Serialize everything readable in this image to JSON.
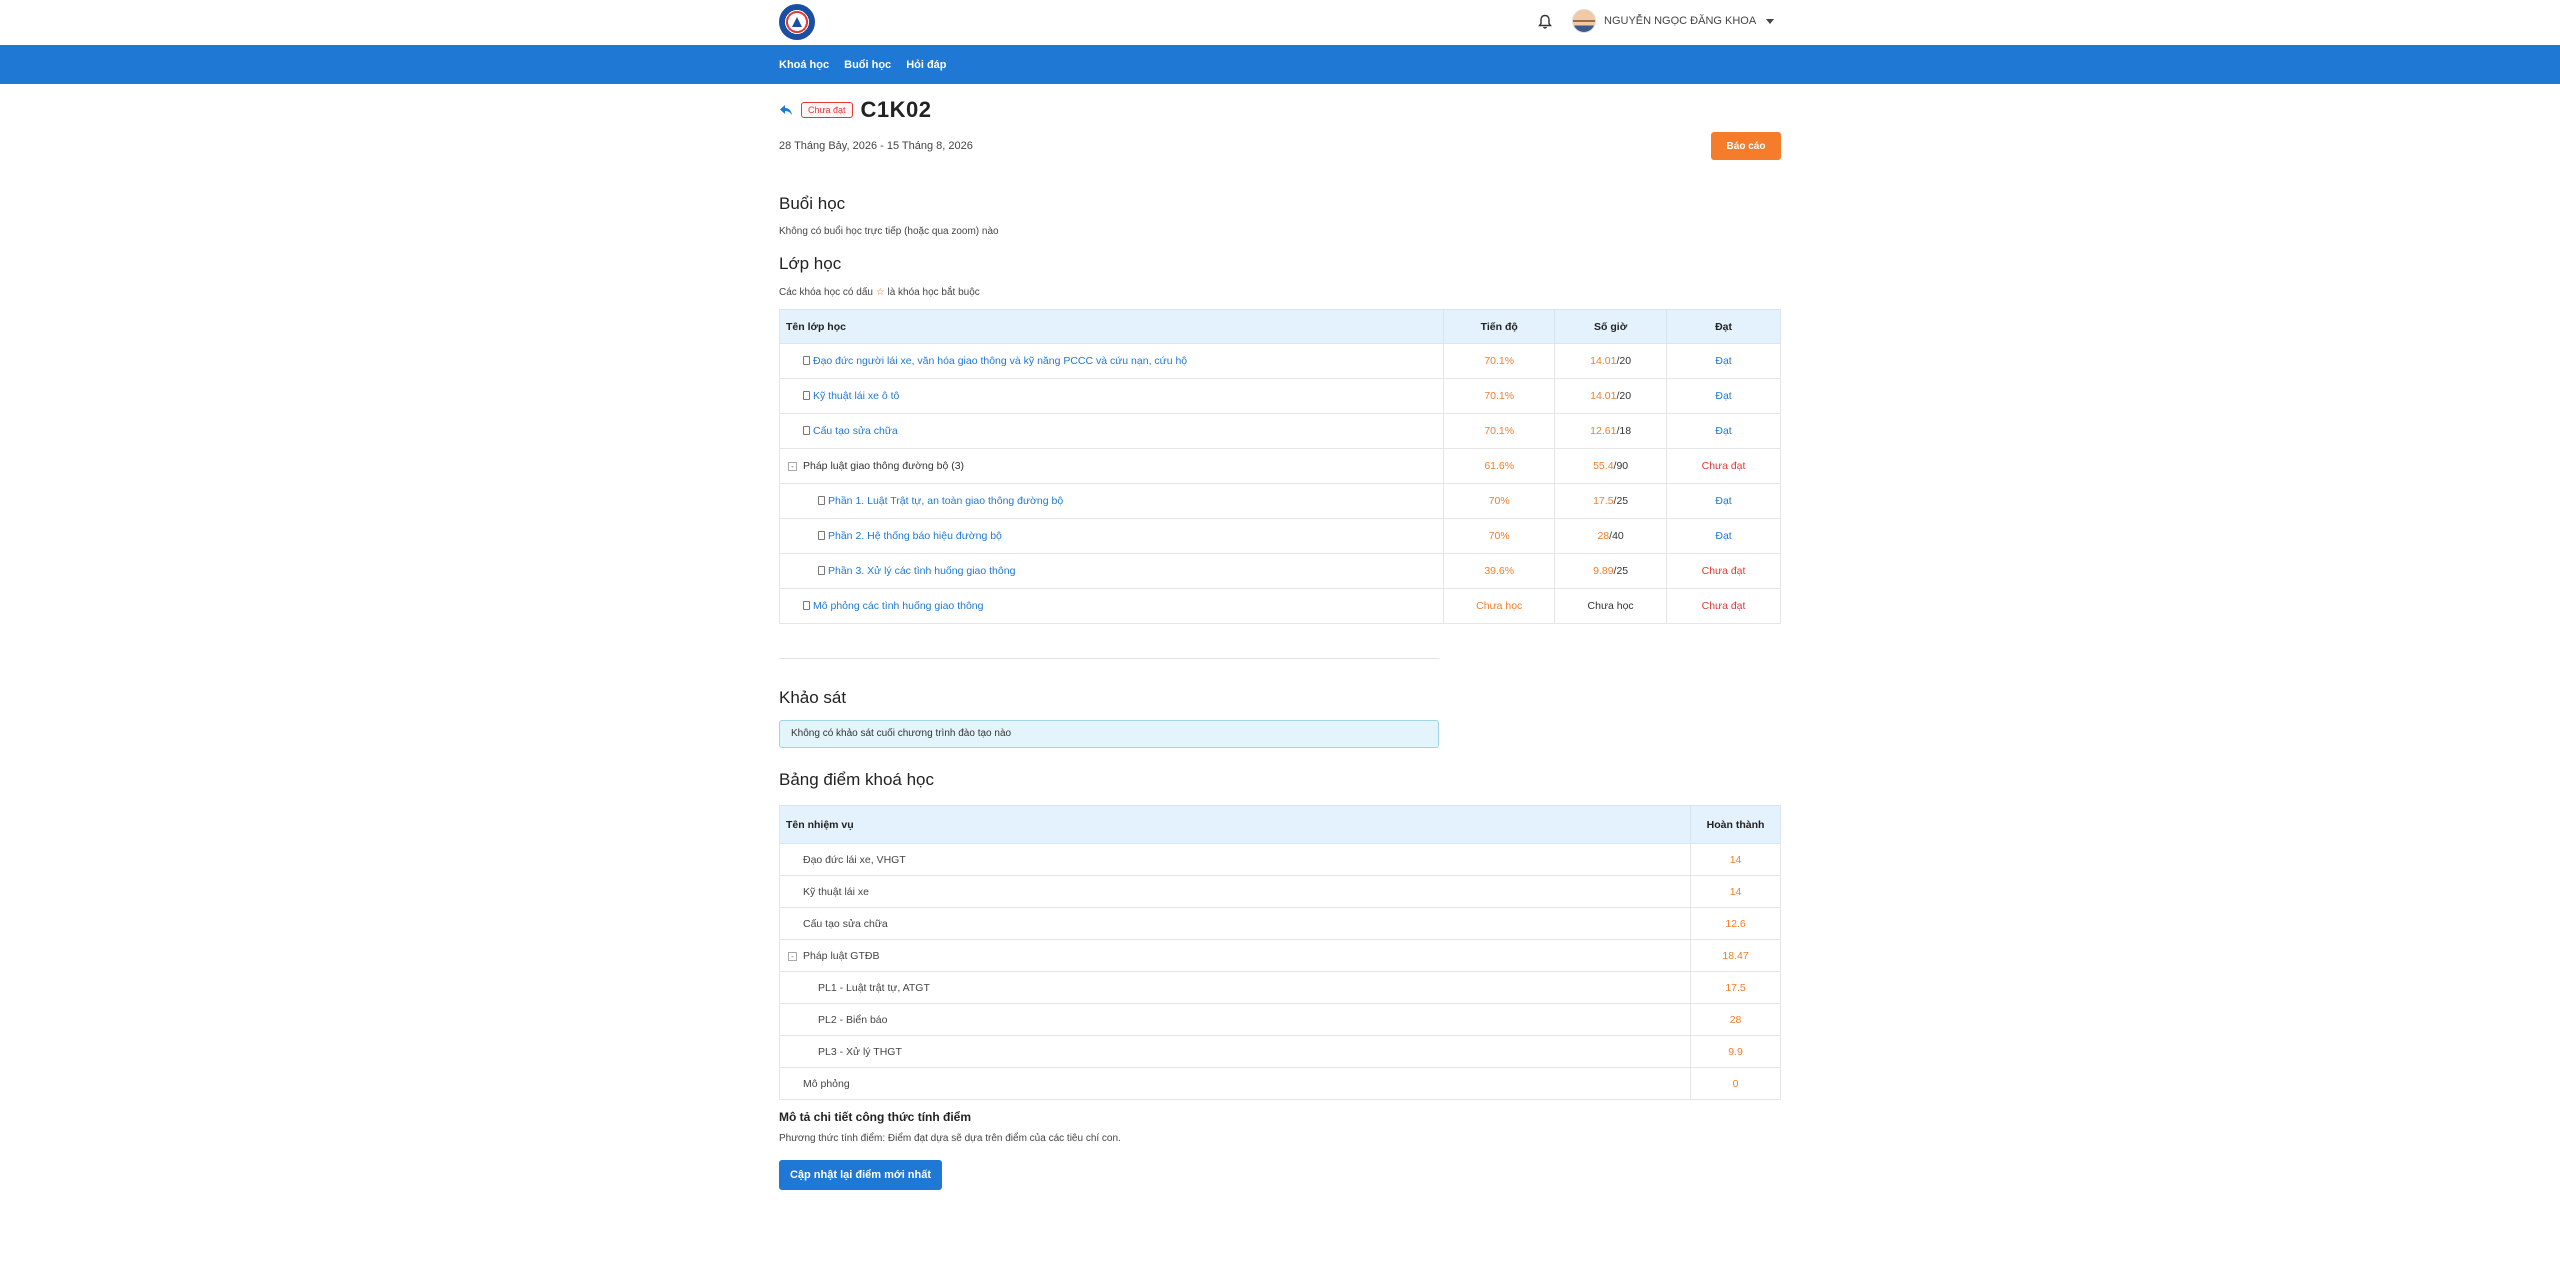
{
  "header": {
    "user_name": "NGUYỄN NGỌC ĐĂNG KHOA"
  },
  "nav": {
    "items": [
      "Khoá học",
      "Buổi học",
      "Hỏi đáp"
    ]
  },
  "course": {
    "status_badge": "Chưa đạt",
    "code": "C1K02",
    "date_range": "28 Tháng Bảy, 2026 - 15 Tháng 8, 2026",
    "report_button": "Báo cáo"
  },
  "sessions": {
    "title": "Buổi học",
    "empty_note": "Không có buổi học trực tiếp (hoặc qua zoom) nào"
  },
  "classes": {
    "title": "Lớp học",
    "note_before": "Các khóa học có dấu",
    "note_star": "☆",
    "note_after": "là khóa học bắt buộc",
    "headers": [
      "Tên lớp học",
      "Tiến độ",
      "Số giờ",
      "Đạt"
    ],
    "rows": [
      {
        "name": "Đạo đức người lái xe, văn hóa giao thông và kỹ năng PCCC và cứu nạn, cứu hộ",
        "progress": "70.1%",
        "hours_done": "14.01",
        "hours_total": "/20",
        "status": "Đạt"
      },
      {
        "name": "Kỹ thuật lái xe ô tô",
        "progress": "70.1%",
        "hours_done": "14.01",
        "hours_total": "/20",
        "status": "Đạt"
      },
      {
        "name": "Cấu tạo sửa chữa",
        "progress": "70.1%",
        "hours_done": "12.61",
        "hours_total": "/18",
        "status": "Đạt"
      },
      {
        "name": "Pháp luật giao thông đường bộ",
        "count": "(3)",
        "toggle": "-",
        "progress": "61.6%",
        "hours_done": "55.4",
        "hours_total": "/90",
        "status": "Chưa đạt"
      },
      {
        "name": "Phần 1. Luật Trật tự, an toàn giao thông đường bộ",
        "progress": "70%",
        "hours_done": "17.5",
        "hours_total": "/25",
        "status": "Đạt"
      },
      {
        "name": "Phần 2. Hệ thống báo hiệu đường bộ",
        "progress": "70%",
        "hours_done": "28",
        "hours_total": "/40",
        "status": "Đạt"
      },
      {
        "name": "Phần 3. Xử lý các tình huống giao thông",
        "progress": "39.6%",
        "hours_done": "9.89",
        "hours_total": "/25",
        "status": "Chưa đạt"
      },
      {
        "name": "Mô phỏng các tình huống giao thông",
        "progress": "Chưa học",
        "hours_text": "Chưa học",
        "status": "Chưa đạt"
      }
    ]
  },
  "survey": {
    "title": "Khảo sát",
    "empty_note": "Không có khảo sát cuối chương trình đào tạo nào"
  },
  "scores": {
    "title": "Bảng điểm khoá học",
    "headers": [
      "Tên nhiệm vụ",
      "Hoàn thành"
    ],
    "rows": [
      {
        "name": "Đạo đức lái xe, VHGT",
        "value": "14"
      },
      {
        "name": "Kỹ thuật lái xe",
        "value": "14"
      },
      {
        "name": "Cấu tạo sửa chữa",
        "value": "12.6"
      },
      {
        "name": "Pháp luật GTĐB",
        "value": "18.47",
        "toggle": "-"
      },
      {
        "name": "PL1 - Luật trật tự, ATGT",
        "value": "17.5"
      },
      {
        "name": "PL2 - Biển báo",
        "value": "28"
      },
      {
        "name": "PL3 - Xử lý THGT",
        "value": "9.9"
      },
      {
        "name": "Mô phỏng",
        "value": "0"
      }
    ]
  },
  "formula": {
    "title": "Mô tả chi tiết công thức tính điểm",
    "description": "Phương thức tính điểm: Điểm đạt dựa sẽ dựa trên điểm của các tiêu chí con.",
    "update_button": "Cập nhật lại điểm mới nhất"
  }
}
